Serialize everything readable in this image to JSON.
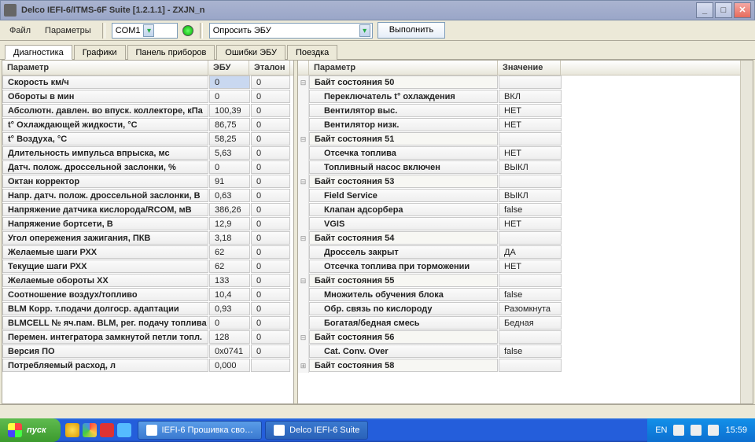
{
  "title": "Delco IEFI-6/ITMS-6F Suite [1.2.1.1] - ZXJN_n",
  "menu": {
    "file": "Файл",
    "params": "Параметры"
  },
  "toolbar": {
    "com": "COM1",
    "poll": "Опросить ЭБУ",
    "exec": "Выполнить"
  },
  "tabs": [
    "Диагностика",
    "Графики",
    "Панель приборов",
    "Ошибки ЭБУ",
    "Поездка"
  ],
  "left": {
    "headers": [
      "Параметр",
      "ЭБУ",
      "Эталон"
    ],
    "rows": [
      {
        "p": "Скорость км/ч",
        "v": "0",
        "e": "0",
        "sel": true
      },
      {
        "p": "Обороты в мин",
        "v": "0",
        "e": "0"
      },
      {
        "p": "Абсолютн. давлен. во впуск. коллекторе, кПа",
        "v": "100,39",
        "e": "0"
      },
      {
        "p": "t° Охлаждающей жидкости, °C",
        "v": "86,75",
        "e": "0"
      },
      {
        "p": "t° Воздуха, °C",
        "v": "58,25",
        "e": "0"
      },
      {
        "p": "Длительность импульса впрыска, мс",
        "v": "5,63",
        "e": "0"
      },
      {
        "p": "Датч. полож. дроссельной заслонки, %",
        "v": "0",
        "e": "0"
      },
      {
        "p": "Октан корректор",
        "v": "91",
        "e": "0"
      },
      {
        "p": "Напр. датч. полож. дроссельной заслонки, В",
        "v": "0,63",
        "e": "0"
      },
      {
        "p": "Напряжение датчика кислорода/RCOM, мВ",
        "v": "386,26",
        "e": "0"
      },
      {
        "p": "Напряжение бортсети, В",
        "v": "12,9",
        "e": "0"
      },
      {
        "p": "Угол опережения зажигания, ПКВ",
        "v": "3,18",
        "e": "0"
      },
      {
        "p": "Желаемые шаги РХХ",
        "v": "62",
        "e": "0"
      },
      {
        "p": "Текущие шаги РХХ",
        "v": "62",
        "e": "0"
      },
      {
        "p": "Желаемые обороты ХХ",
        "v": "133",
        "e": "0"
      },
      {
        "p": "Соотношение воздух/топливо",
        "v": "10,4",
        "e": "0"
      },
      {
        "p": "BLM Корр. т.подачи долгоср. адаптации",
        "v": "0,93",
        "e": "0"
      },
      {
        "p": "BLMCELL № яч.пам. BLM, рег. подачу топлива",
        "v": "0",
        "e": "0"
      },
      {
        "p": "Перемен. интегратора замкнутой петли топл.",
        "v": "128",
        "e": "0"
      },
      {
        "p": "Версия ПО",
        "v": "0x0741",
        "e": "0"
      },
      {
        "p": "Потребляемый расход, л",
        "v": "0,000",
        "e": ""
      }
    ]
  },
  "right": {
    "headers": [
      "Параметр",
      "Значение"
    ],
    "rows": [
      {
        "t": "branch",
        "p": "Байт состояния 50",
        "v": "",
        "exp": "-"
      },
      {
        "t": "leaf",
        "p": "Переключатель t° охлаждения",
        "v": "ВКЛ"
      },
      {
        "t": "leaf",
        "p": "Вентилятор выс.",
        "v": "НЕТ"
      },
      {
        "t": "leaf",
        "p": "Вентилятор низк.",
        "v": "НЕТ"
      },
      {
        "t": "branch",
        "p": "Байт состояния 51",
        "v": "",
        "exp": "-"
      },
      {
        "t": "leaf",
        "p": "Отсечка топлива",
        "v": "НЕТ"
      },
      {
        "t": "leaf",
        "p": "Топливный насос включен",
        "v": "ВЫКЛ"
      },
      {
        "t": "branch",
        "p": "Байт состояния 53",
        "v": "",
        "exp": "-"
      },
      {
        "t": "leaf",
        "p": "Field Service",
        "v": "ВЫКЛ"
      },
      {
        "t": "leaf",
        "p": "Клапан адсорбера",
        "v": "false"
      },
      {
        "t": "leaf",
        "p": "VGIS",
        "v": "НЕТ"
      },
      {
        "t": "branch",
        "p": "Байт состояния 54",
        "v": "",
        "exp": "-"
      },
      {
        "t": "leaf",
        "p": "Дроссель закрыт",
        "v": "ДА"
      },
      {
        "t": "leaf",
        "p": "Отсечка топлива при торможении",
        "v": "НЕТ"
      },
      {
        "t": "branch",
        "p": "Байт состояния 55",
        "v": "",
        "exp": "-"
      },
      {
        "t": "leaf",
        "p": "Множитель обучения блока",
        "v": "false"
      },
      {
        "t": "leaf",
        "p": "Обр. связь по кислороду",
        "v": "Разомкнута"
      },
      {
        "t": "leaf",
        "p": "Богатая/бедная смесь",
        "v": "Бедная"
      },
      {
        "t": "branch",
        "p": "Байт состояния 56",
        "v": "",
        "exp": "-"
      },
      {
        "t": "leaf",
        "p": "Cat. Conv. Over",
        "v": "false"
      },
      {
        "t": "branch",
        "p": "Байт состояния 58",
        "v": "",
        "exp": "+"
      }
    ]
  },
  "taskbar": {
    "start": "пуск",
    "tasks": [
      "IEFI-6 Прошивка сво…",
      "Delco IEFI-6 Suite"
    ],
    "lang": "EN",
    "time": "15:59"
  }
}
